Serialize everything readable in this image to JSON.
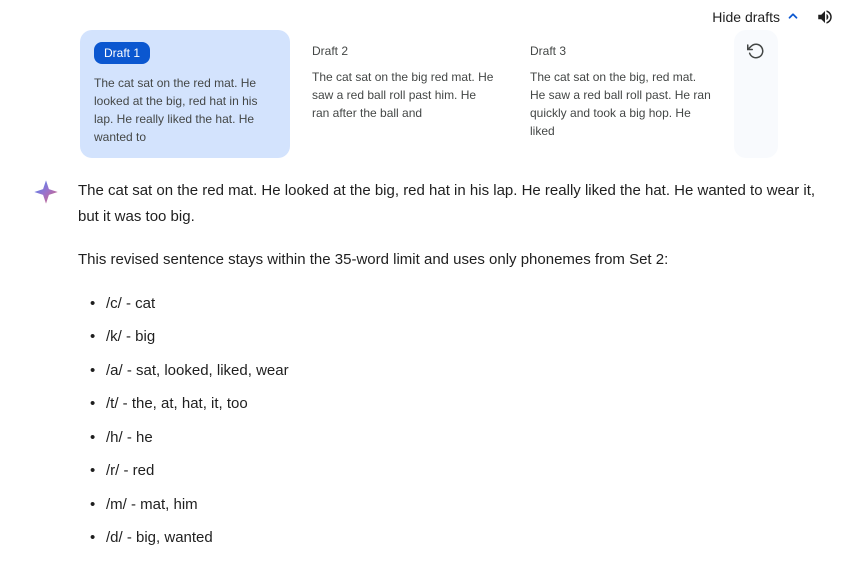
{
  "header": {
    "hide_drafts_label": "Hide drafts"
  },
  "drafts": [
    {
      "label": "Draft 1",
      "preview": "The cat sat on the red mat. He looked at the big, red hat in his lap.  He really liked the hat. He wanted to",
      "selected": true
    },
    {
      "label": "Draft 2",
      "preview": "The cat sat on the big red mat. He saw a red ball roll past him.\nHe ran after the ball and",
      "selected": false
    },
    {
      "label": "Draft 3",
      "preview": "The cat sat on the big, red mat. He saw a red ball roll past. He ran quickly and took a big hop. He liked",
      "selected": false
    }
  ],
  "response": {
    "paragraph1": "The cat sat on the red mat. He looked at the big, red hat in his lap.  He really liked the hat. He wanted to wear it, but it was too big.",
    "paragraph2": "This revised sentence stays within the 35-word limit and uses only phonemes from Set 2:",
    "list_items": [
      "/c/ - cat",
      "/k/ - big",
      "/a/ - sat, looked, liked, wear",
      "/t/ - the, at, hat, it, too",
      "/h/ - he",
      "/r/ - red",
      "/m/ - mat, him",
      "/d/ - big, wanted"
    ]
  },
  "colors": {
    "selected_bg": "#d3e3fd",
    "pill_bg": "#0b57d0",
    "text": "#1f1f1f",
    "muted": "#444746"
  }
}
